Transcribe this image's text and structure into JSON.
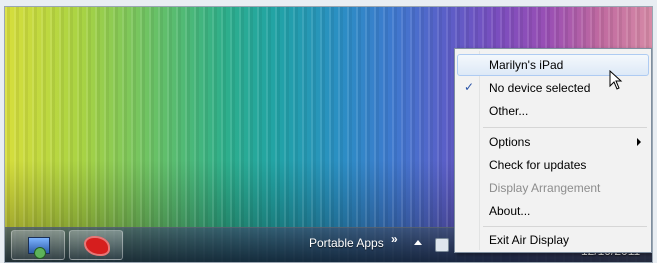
{
  "taskbar": {
    "toolbar_label": "Portable Apps",
    "toolbar_chevron": "»",
    "clock": "12/19/2011",
    "tray_icons": [
      "network-icon",
      "airdisplay-icon",
      "chat-icon",
      "security-icon",
      "monitor-icon",
      "volume-muted-icon"
    ]
  },
  "context_menu": {
    "items": [
      {
        "label": "Marilyn's iPad"
      },
      {
        "label": "No device selected",
        "checked": true
      },
      {
        "label": "Other..."
      },
      {
        "label": "Options",
        "submenu": true
      },
      {
        "label": "Check for updates"
      },
      {
        "label": "Display Arrangement",
        "disabled": true
      },
      {
        "label": "About..."
      },
      {
        "label": "Exit Air Display"
      }
    ],
    "check_glyph": "✓"
  },
  "colors": {
    "menu_bg": "#f2f2f2",
    "hover_border": "#aecbf2",
    "disabled_text": "#8d8d8d",
    "check": "#2a54a8"
  }
}
